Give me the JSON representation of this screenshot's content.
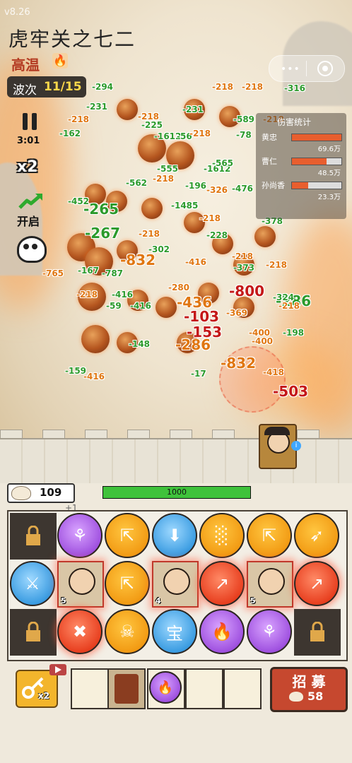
{
  "version": "v8.26",
  "level_title": "虎牢关之七二",
  "weather": {
    "label": "高温",
    "icon": "fire-icon"
  },
  "wave": {
    "label": "波次",
    "value": "11/15"
  },
  "hud": {
    "pause_icon": "pause-icon",
    "timer": "3:01",
    "speed": "x2",
    "auto_label": "开启"
  },
  "damage_stats": {
    "title": "伤害统计",
    "rows": [
      {
        "name": "黄忠",
        "value": "69.6万",
        "ratio": 1.0
      },
      {
        "name": "曹仁",
        "value": "48.5万",
        "ratio": 0.7
      },
      {
        "name": "孙尚香",
        "value": "23.3万",
        "ratio": 0.33
      }
    ]
  },
  "damage_numbers": [
    "-294",
    "-218",
    "-218",
    "-316",
    "-231",
    "-218",
    "-231",
    "-589",
    "-218",
    "-162",
    "-225",
    "-1612",
    "-56",
    "-218",
    "-78",
    "-218",
    "-555",
    "-1612",
    "-565",
    "-562",
    "-218",
    "-196",
    "-326",
    "-476",
    "-452",
    "-265",
    "-1485",
    "-378",
    "-218",
    "-267",
    "-228",
    "-218",
    "-302",
    "-832",
    "-416",
    "-218",
    "-373",
    "-218",
    "-167",
    "-787",
    "-280",
    "-436",
    "-800",
    "-416",
    "-286",
    "-218",
    "-103",
    "-153",
    "-59",
    "-416",
    "-400",
    "-286",
    "-198",
    "-400",
    "-832",
    "-503",
    "-148",
    "-159",
    "-416",
    "-17",
    "-369",
    "-324",
    "-218",
    "-418",
    "-765"
  ],
  "wall_hp": {
    "value": "1000",
    "ratio": 1.0
  },
  "buns": {
    "count": "109",
    "bonus": "+1"
  },
  "recruit": {
    "label": "招 募",
    "cost": "58"
  },
  "key_multiplier": "x2",
  "board": {
    "row1": [
      "lock-icon",
      "jar-icon",
      "spread-arrows-icon",
      "boot-icon",
      "triple-claw-icon",
      "spread-arrows-icon",
      "fire-arrow-icon"
    ],
    "row2": [
      "sword-upgrade-icon",
      "hero-huang-zhong",
      "spread-arrows-icon",
      "hero-cao-ren",
      "arrow-up-right-icon",
      "hero-sun-shangxiang",
      "arrow-up-right-icon"
    ],
    "row3": [
      "lock-icon",
      "crossed-arrows-icon",
      "skull-icon",
      "treasure-bag-icon",
      "flame-icon",
      "jar-icon",
      "lock-icon"
    ],
    "hero_levels": [
      "5",
      "4",
      "5"
    ],
    "treasure_label": "宝"
  },
  "colors": {
    "damage_orange": "#e07610",
    "damage_green": "#2b9a2b",
    "damage_red": "#c41818",
    "hp_green": "#3fc23b"
  }
}
